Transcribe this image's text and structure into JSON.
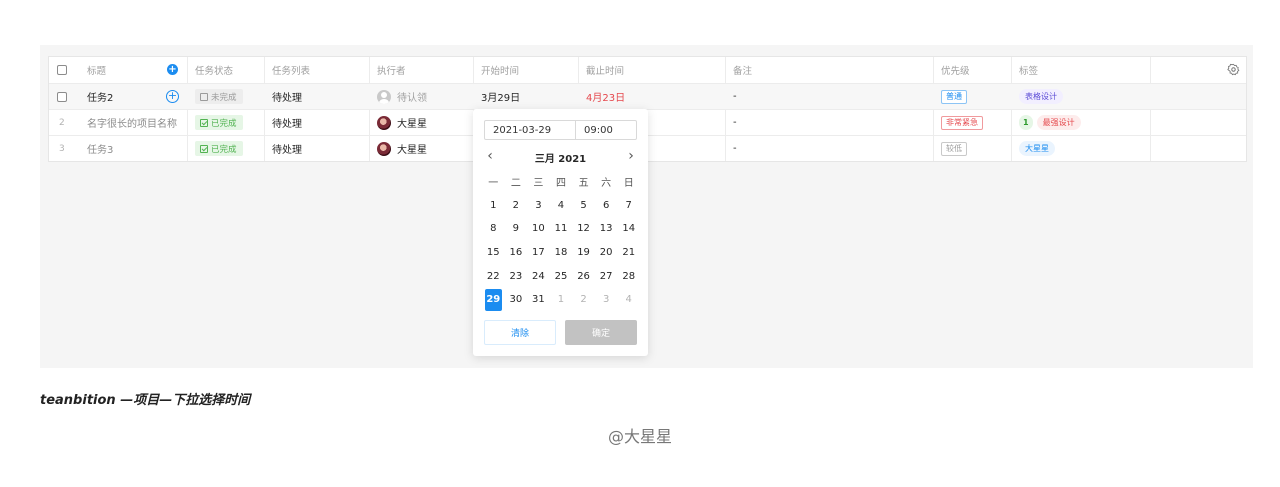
{
  "table": {
    "headers": {
      "title": "标题",
      "status": "任务状态",
      "list": "任务列表",
      "executor": "执行者",
      "start": "开始时间",
      "due": "截止时间",
      "note": "备注",
      "priority": "优先级",
      "tags": "标签"
    },
    "rows": [
      {
        "index": "",
        "title": "任务2",
        "status": "未完成",
        "list": "待处理",
        "executor": "待认领",
        "start": "3月29日",
        "due": "4月23日",
        "note": "-",
        "priority": "普通",
        "tags": [
          "表格设计"
        ]
      },
      {
        "index": "2",
        "title": "名字很长的项目名称",
        "status": "已完成",
        "list": "待处理",
        "executor": "大星星",
        "start": "",
        "due": "",
        "note": "-",
        "priority": "非常紧急",
        "tag_count": "1",
        "tags": [
          "最强设计"
        ]
      },
      {
        "index": "3",
        "title": "任务3",
        "status": "已完成",
        "list": "待处理",
        "executor": "大星星",
        "start": "",
        "due": "",
        "note": "-",
        "priority": "较低",
        "tags": [
          "大星星"
        ]
      }
    ]
  },
  "picker": {
    "date_value": "2021-03-29",
    "time_value": "09:00",
    "month_label": "三月 2021",
    "prev_icon": "chevron-left-icon",
    "next_icon": "chevron-right-icon",
    "weekdays": [
      "一",
      "二",
      "三",
      "四",
      "五",
      "六",
      "日"
    ],
    "weeks": [
      [
        "1",
        "2",
        "3",
        "4",
        "5",
        "6",
        "7"
      ],
      [
        "8",
        "9",
        "10",
        "11",
        "12",
        "13",
        "14"
      ],
      [
        "15",
        "16",
        "17",
        "18",
        "19",
        "20",
        "21"
      ],
      [
        "22",
        "23",
        "24",
        "25",
        "26",
        "27",
        "28"
      ],
      [
        "29",
        "30",
        "31",
        "1",
        "2",
        "3",
        "4"
      ]
    ],
    "selected_day": "29",
    "clear_label": "清除",
    "ok_label": "确定"
  },
  "colors": {
    "accent": "#1b8cf0",
    "danger": "#e5484d",
    "success": "#52b352"
  },
  "caption": "teanbition —项目—下拉选择时间",
  "credit": "@大星星"
}
